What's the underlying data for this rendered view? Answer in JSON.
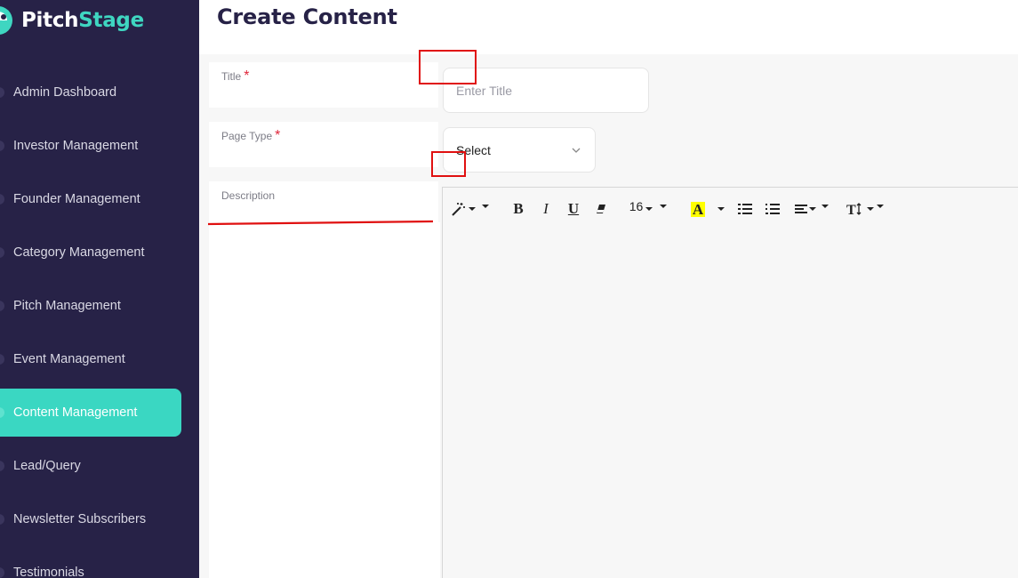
{
  "brand": {
    "name_part1": "Pitch",
    "name_part2": "Stage",
    "primary": "#272247",
    "accent": "#3ad7c2"
  },
  "sidebar": {
    "items": [
      {
        "label": "Admin Dashboard",
        "active": false
      },
      {
        "label": "Investor Management",
        "active": false
      },
      {
        "label": "Founder Management",
        "active": false
      },
      {
        "label": "Category Management",
        "active": false
      },
      {
        "label": "Pitch Management",
        "active": false
      },
      {
        "label": "Event Management",
        "active": false
      },
      {
        "label": "Content Management",
        "active": true
      },
      {
        "label": "Lead/Query",
        "active": false
      },
      {
        "label": "Newsletter Subscribers",
        "active": false
      },
      {
        "label": "Testimonials",
        "active": false
      }
    ]
  },
  "header": {
    "title": "Create Content"
  },
  "form": {
    "title": {
      "label": "Title",
      "required_mark": "*",
      "value": "",
      "placeholder": "Enter Title"
    },
    "page_type": {
      "label": "Page Type",
      "required_mark": "*",
      "selected": "Select"
    },
    "description": {
      "label": "Description"
    }
  },
  "editor": {
    "toolbar": {
      "style_icon": "magic-wand-icon",
      "bold": "B",
      "italic": "I",
      "underline": "U",
      "eraser_icon": "eraser-icon",
      "font_size": "16",
      "highlight": "A",
      "highlight_color": "#ffff00",
      "unordered_list_icon": "list-ul-icon",
      "ordered_list_icon": "list-ol-icon",
      "align_icon": "align-left-icon",
      "line_height_icon": "text-height-icon"
    }
  }
}
